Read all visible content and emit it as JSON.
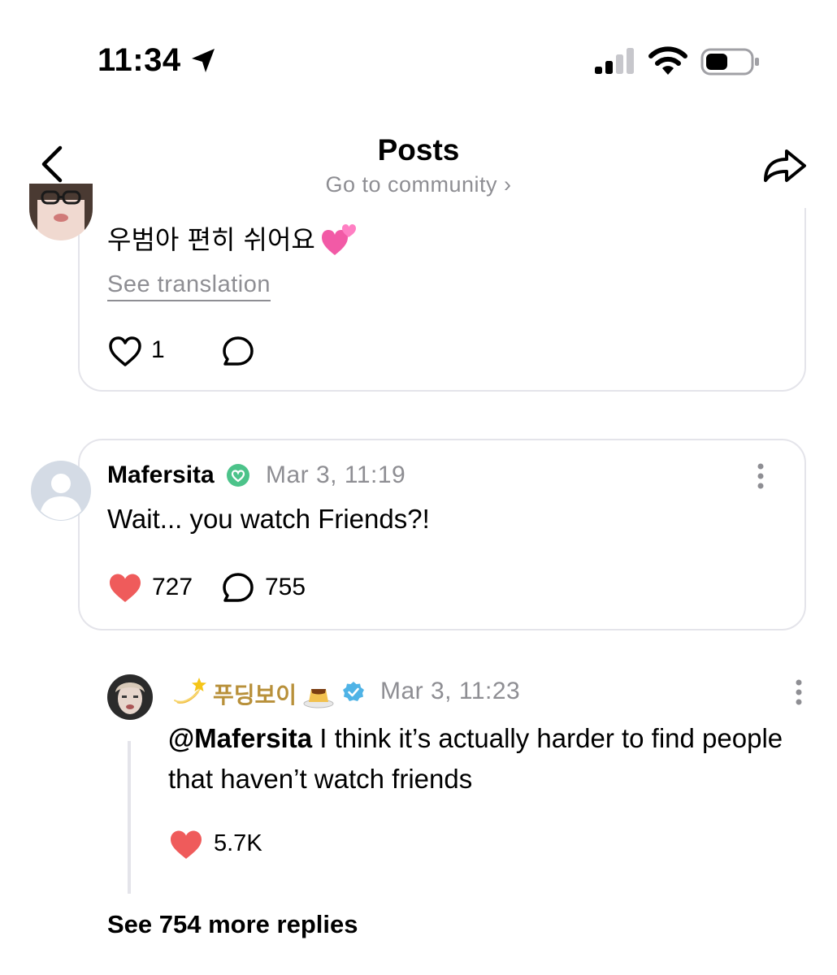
{
  "status_bar": {
    "time": "11:34"
  },
  "nav": {
    "title": "Posts",
    "subtitle": "Go to community ›"
  },
  "post": {
    "text": "우범아 편히 쉬어요",
    "emoji": "two-hearts-emoji",
    "see_translation": "See translation",
    "like_count": "1"
  },
  "comment": {
    "username": "Mafersita",
    "timestamp": "Mar 3, 11:19",
    "text": "Wait... you watch Friends?!",
    "like_count": "727",
    "reply_count": "755"
  },
  "reply": {
    "username": "푸딩보이",
    "timestamp": "Mar 3, 11:23",
    "mention": "@Mafersita",
    "text": " I think it’s actually harder to find people that haven’t watch friends",
    "like_count": "5.7K"
  },
  "see_more": "See 754 more replies",
  "colors": {
    "accent_heart": "#ef5b5b",
    "verified_green": "#4cc38a",
    "verified_blue": "#4fb3e6",
    "secondary_text": "#8e8e93",
    "card_border": "#e4e4ea",
    "username_gold": "#b8903a"
  }
}
